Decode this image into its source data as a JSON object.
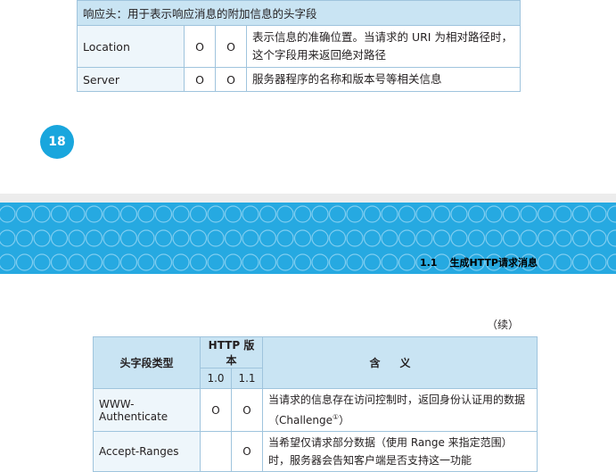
{
  "top_table": {
    "section_title": "响应头：用于表示响应消息的附加信息的头字段",
    "rows": [
      {
        "name": "Location",
        "v10": "O",
        "v11": "O",
        "meaning": "表示信息的准确位置。当请求的 URI 为相对路径时，这个字段用来返回绝对路径"
      },
      {
        "name": "Server",
        "v10": "O",
        "v11": "O",
        "meaning": "服务器程序的名称和版本号等相关信息"
      }
    ]
  },
  "page_number": "18",
  "banner": {
    "section_number": "1.1",
    "section_title": "生成HTTP请求消息",
    "color": "#26a9e1"
  },
  "continued_label": "（续）",
  "bottom_table": {
    "header": {
      "type": "头字段类型",
      "http_version": "HTTP 版本",
      "v10": "1.0",
      "v11": "1.1",
      "meaning": "含义"
    },
    "rows": [
      {
        "name": "WWW-Authenticate",
        "v10": "O",
        "v11": "O",
        "meaning": "当请求的信息存在访问控制时，返回身份认证用的数据（Challenge",
        "footnote": "①",
        "meaning_tail": "）"
      },
      {
        "name": "Accept-Ranges",
        "v10": "",
        "v11": "O",
        "meaning": "当希望仅请求部分数据（使用 Range 来指定范围）时，服务器会告知客户端是否支持这一功能"
      }
    ]
  }
}
